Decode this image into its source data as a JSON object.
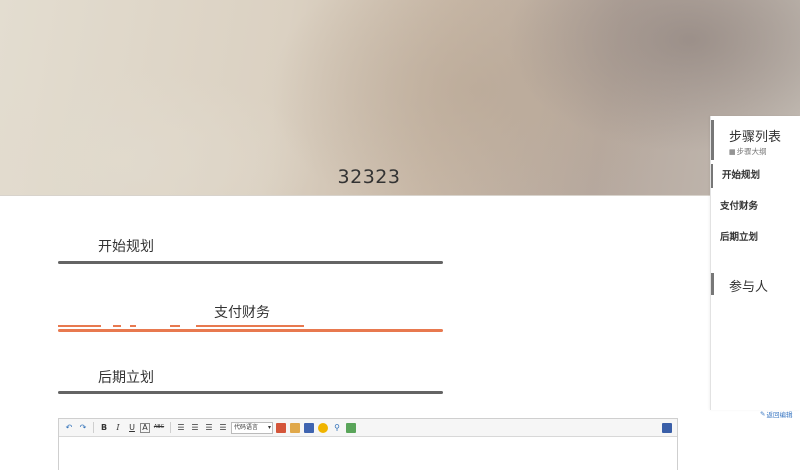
{
  "hero": {
    "title": "32323"
  },
  "steps": [
    {
      "label": "开始规划",
      "state": "inactive"
    },
    {
      "label": "支付财务",
      "state": "active"
    },
    {
      "label": "后期立划",
      "state": "inactive"
    }
  ],
  "editor": {
    "language_select": "代码语言",
    "toolbar_icons": [
      "undo-icon",
      "redo-icon",
      "bold-icon",
      "italic-icon",
      "underline-icon",
      "font-color-icon",
      "strikethrough-icon",
      "align-left-icon",
      "align-center-icon",
      "align-right-icon",
      "justify-icon",
      "image-icon",
      "folder-icon",
      "save-icon",
      "emoticon-icon",
      "attachment-icon",
      "map-icon",
      "preview-icon"
    ],
    "bold": "B",
    "italic": "I",
    "underline": "U",
    "font_color": "A",
    "strike": "ABC"
  },
  "sidebar": {
    "title": "步骤列表",
    "subtitle": "步骤大纲",
    "items": [
      {
        "label": "开始规划"
      },
      {
        "label": "支付财务"
      },
      {
        "label": "后期立划"
      }
    ],
    "participants": "参与人"
  },
  "back_link": "返回编辑",
  "colors": {
    "accent": "#e8794f",
    "bar": "#646464",
    "link": "#3a77c2"
  }
}
